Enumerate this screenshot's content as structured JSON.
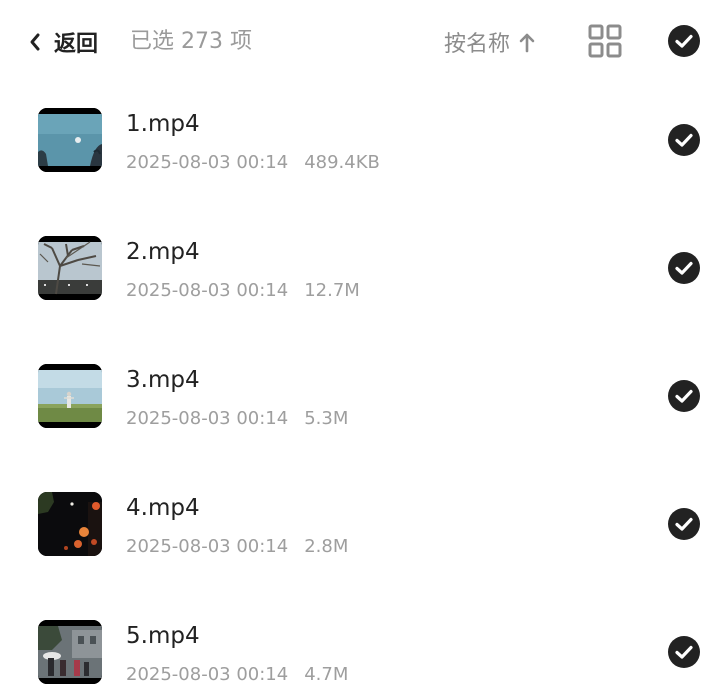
{
  "header": {
    "back_label": "返回",
    "selected_text": "已选 273 项",
    "sort_label": "按名称",
    "icons": {
      "back": "chevron-left-icon",
      "sort": "arrow-up-icon",
      "view": "grid-view-icon",
      "select_all": "check-circle-icon"
    }
  },
  "files": [
    {
      "name": "1.mp4",
      "date": "2025-08-03 00:14",
      "size": "489.4KB",
      "selected": true
    },
    {
      "name": "2.mp4",
      "date": "2025-08-03 00:14",
      "size": "12.7M",
      "selected": true
    },
    {
      "name": "3.mp4",
      "date": "2025-08-03 00:14",
      "size": "5.3M",
      "selected": true
    },
    {
      "name": "4.mp4",
      "date": "2025-08-03 00:14",
      "size": "2.8M",
      "selected": true
    },
    {
      "name": "5.mp4",
      "date": "2025-08-03 00:14",
      "size": "4.7M",
      "selected": true
    }
  ],
  "colors": {
    "text_primary": "#222222",
    "text_secondary": "#9e9e9e",
    "check_fill": "#222222",
    "icon_gray": "#8c8c8c"
  }
}
